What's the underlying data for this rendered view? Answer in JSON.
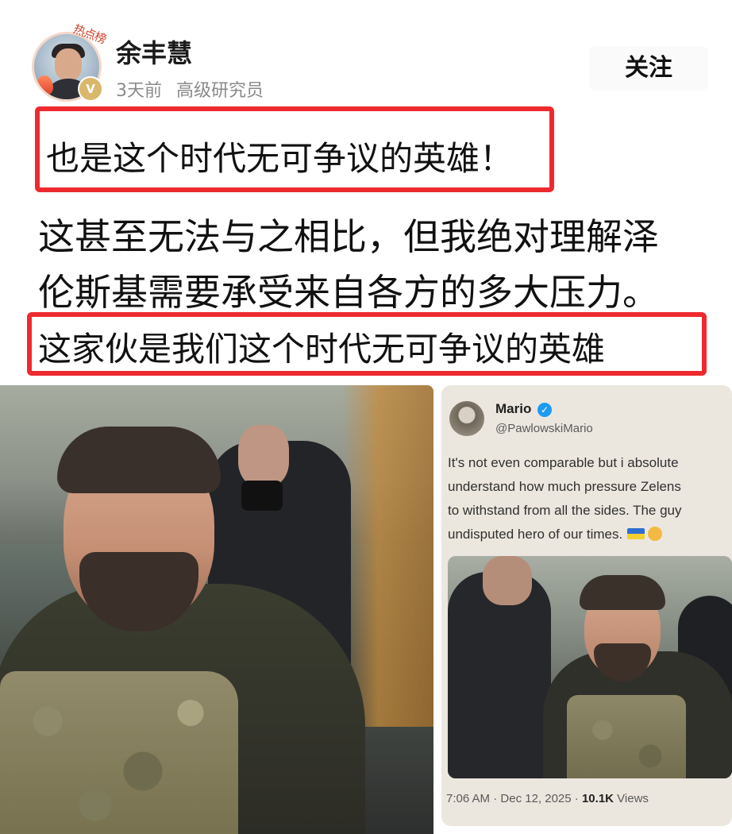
{
  "post": {
    "author": "余丰慧",
    "time": "3天前",
    "role": "高级研究员",
    "follow_label": "关注",
    "hot_tag": "热点榜",
    "verify_mark": "V"
  },
  "content": {
    "line1": "也是这个时代无可争议的英雄！",
    "line2": "这甚至无法与之相比，但我绝对理解泽",
    "line3": "伦斯基需要承受来自各方的多大压力。",
    "line4": "这家伙是我们这个时代无可争议的英雄"
  },
  "tweet": {
    "name": "Mario",
    "handle": "@PawlowskiMario",
    "text_lines": [
      "It's not even comparable but i absolute",
      "understand how much pressure Zelens",
      "to withstand from all the sides. The guy",
      "undisputed hero of our times."
    ],
    "time": "7:06 AM",
    "date": "Dec 12, 2025",
    "views_count": "10.1K",
    "views_label": "Views",
    "separator": "·"
  },
  "colors": {
    "highlight": "#ee2a2f",
    "verified": "#1d9bf0",
    "badge": "#d9b76b"
  },
  "icons": {
    "verify_badge": "verified-v-icon",
    "tweet_verified": "checkmark-badge-icon",
    "flag": "ukraine-flag-icon",
    "emoji": "face-emoji-icon"
  }
}
